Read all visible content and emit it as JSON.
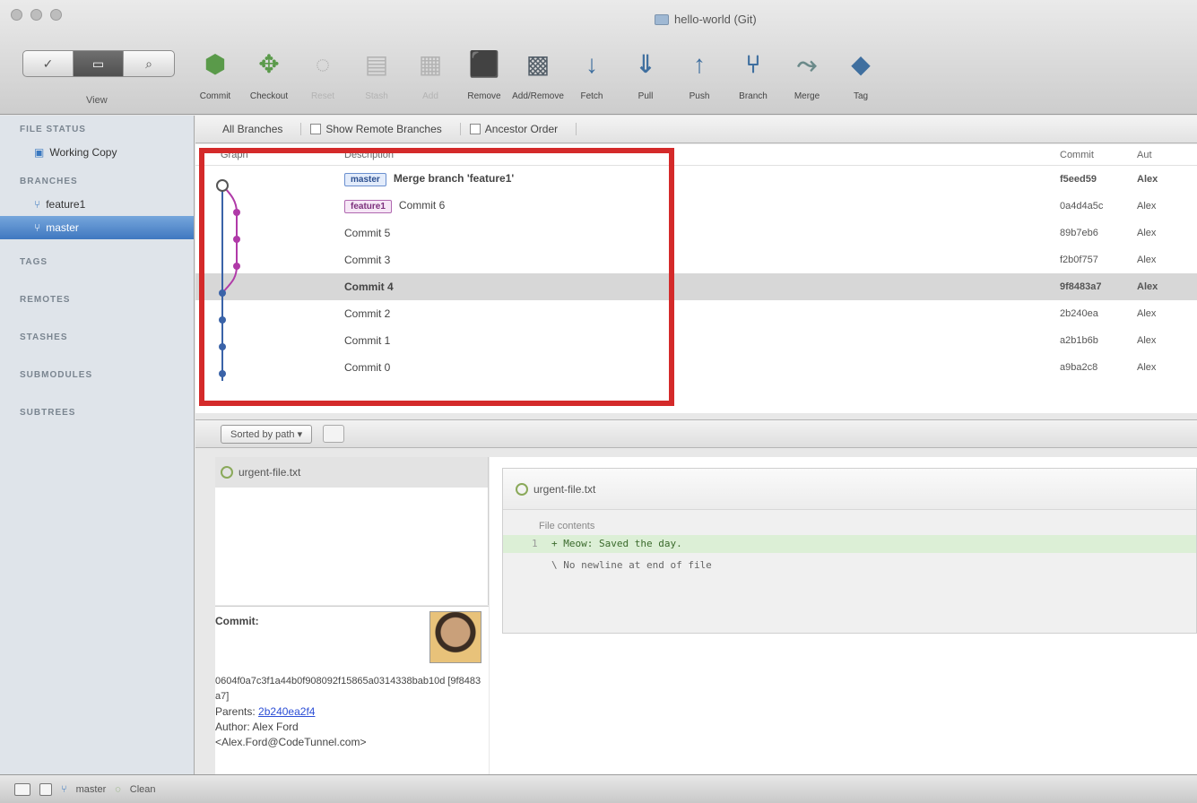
{
  "window": {
    "title": "hello-world (Git)"
  },
  "view": {
    "label": "View",
    "modes": [
      "✓",
      "▭",
      "⌕"
    ]
  },
  "toolbar": {
    "buttons": [
      {
        "label": "Commit",
        "icon": "commit-icon",
        "glyph": "⬢",
        "color": "green",
        "enabled": true
      },
      {
        "label": "Checkout",
        "icon": "checkout-icon",
        "glyph": "✥",
        "color": "green",
        "enabled": true
      },
      {
        "label": "Reset",
        "icon": "reset-icon",
        "glyph": "◌",
        "color": "gray",
        "enabled": false
      },
      {
        "label": "Stash",
        "icon": "stash-icon",
        "glyph": "▤",
        "color": "gray",
        "enabled": false
      },
      {
        "label": "Add",
        "icon": "add-icon",
        "glyph": "▦",
        "color": "gray",
        "enabled": false
      },
      {
        "label": "Remove",
        "icon": "remove-icon",
        "glyph": "⬛",
        "color": "red",
        "enabled": true
      },
      {
        "label": "Add/Remove",
        "icon": "add-remove-icon",
        "glyph": "▩",
        "color": "dark",
        "enabled": true
      },
      {
        "label": "Fetch",
        "icon": "fetch-icon",
        "glyph": "↓",
        "color": "blue",
        "enabled": true
      },
      {
        "label": "Pull",
        "icon": "pull-icon",
        "glyph": "⇓",
        "color": "blue",
        "enabled": true
      },
      {
        "label": "Push",
        "icon": "push-icon",
        "glyph": "↑",
        "color": "blue",
        "enabled": true
      },
      {
        "label": "Branch",
        "icon": "branch-icon",
        "glyph": "⑂",
        "color": "blue",
        "enabled": true
      },
      {
        "label": "Merge",
        "icon": "merge-icon",
        "glyph": "⤳",
        "color": "olive",
        "enabled": true
      },
      {
        "label": "Tag",
        "icon": "tag-icon",
        "glyph": "◆",
        "color": "blue",
        "enabled": true
      }
    ]
  },
  "sidebar": {
    "file_status_header": "FILE STATUS",
    "working_copy": "Working Copy",
    "branches_header": "BRANCHES",
    "branches": [
      {
        "name": "feature1",
        "selected": false
      },
      {
        "name": "master",
        "selected": true
      }
    ],
    "tags_header": "TAGS",
    "remotes_header": "REMOTES",
    "stashes_header": "STASHES",
    "submodules_header": "SUBMODULES",
    "subtrees_header": "SUBTREES"
  },
  "filter": {
    "branches": "All Branches",
    "remote": "Show Remote Branches",
    "order": "Ancestor Order"
  },
  "log": {
    "headers": {
      "graph": "Graph",
      "description": "Description",
      "commit": "Commit",
      "author": "Aut"
    },
    "rows": [
      {
        "tag": "master",
        "tag_kind": "master",
        "description": "Merge branch 'feature1'",
        "commit": "f5eed59",
        "author": "Alex",
        "bold": true,
        "selected": false
      },
      {
        "tag": "feature1",
        "tag_kind": "feature",
        "description": "Commit 6",
        "commit": "0a4d4a5c",
        "author": "Alex",
        "bold": false,
        "selected": false
      },
      {
        "tag": "",
        "tag_kind": "",
        "description": "Commit 5",
        "commit": "89b7eb6",
        "author": "Alex",
        "bold": false,
        "selected": false
      },
      {
        "tag": "",
        "tag_kind": "",
        "description": "Commit 3",
        "commit": "f2b0f757",
        "author": "Alex",
        "bold": false,
        "selected": false
      },
      {
        "tag": "",
        "tag_kind": "",
        "description": "Commit 4",
        "commit": "9f8483a7",
        "author": "Alex",
        "bold": true,
        "selected": true
      },
      {
        "tag": "",
        "tag_kind": "",
        "description": "Commit 2",
        "commit": "2b240ea",
        "author": "Alex",
        "bold": false,
        "selected": false
      },
      {
        "tag": "",
        "tag_kind": "",
        "description": "Commit 1",
        "commit": "a2b1b6b",
        "author": "Alex",
        "bold": false,
        "selected": false
      },
      {
        "tag": "",
        "tag_kind": "",
        "description": "Commit 0",
        "commit": "a9ba2c8",
        "author": "Alex",
        "bold": false,
        "selected": false
      }
    ]
  },
  "lower": {
    "sort": "Sorted by path ▾"
  },
  "files": [
    {
      "name": "urgent-file.txt"
    }
  ],
  "commit_info": {
    "label": "Commit:",
    "sha": "0604f0a7c3f1a44b0f908092f15865a0314338bab10d [9f8483a7]",
    "parents_label": "Parents:",
    "parents_value": "2b240ea2f4",
    "author_line": "Author: Alex Ford",
    "email_line": "<Alex.Ford@CodeTunnel.com>"
  },
  "diff": {
    "file": "urgent-file.txt",
    "hunk": "File contents",
    "lines": [
      {
        "num": "1",
        "text": "+ Meow: Saved the day.",
        "kind": "add"
      },
      {
        "num": "",
        "text": "\\ No newline at end of file",
        "kind": "ctx"
      }
    ]
  },
  "statusbar": {
    "branch": "master",
    "clean": "Clean"
  }
}
